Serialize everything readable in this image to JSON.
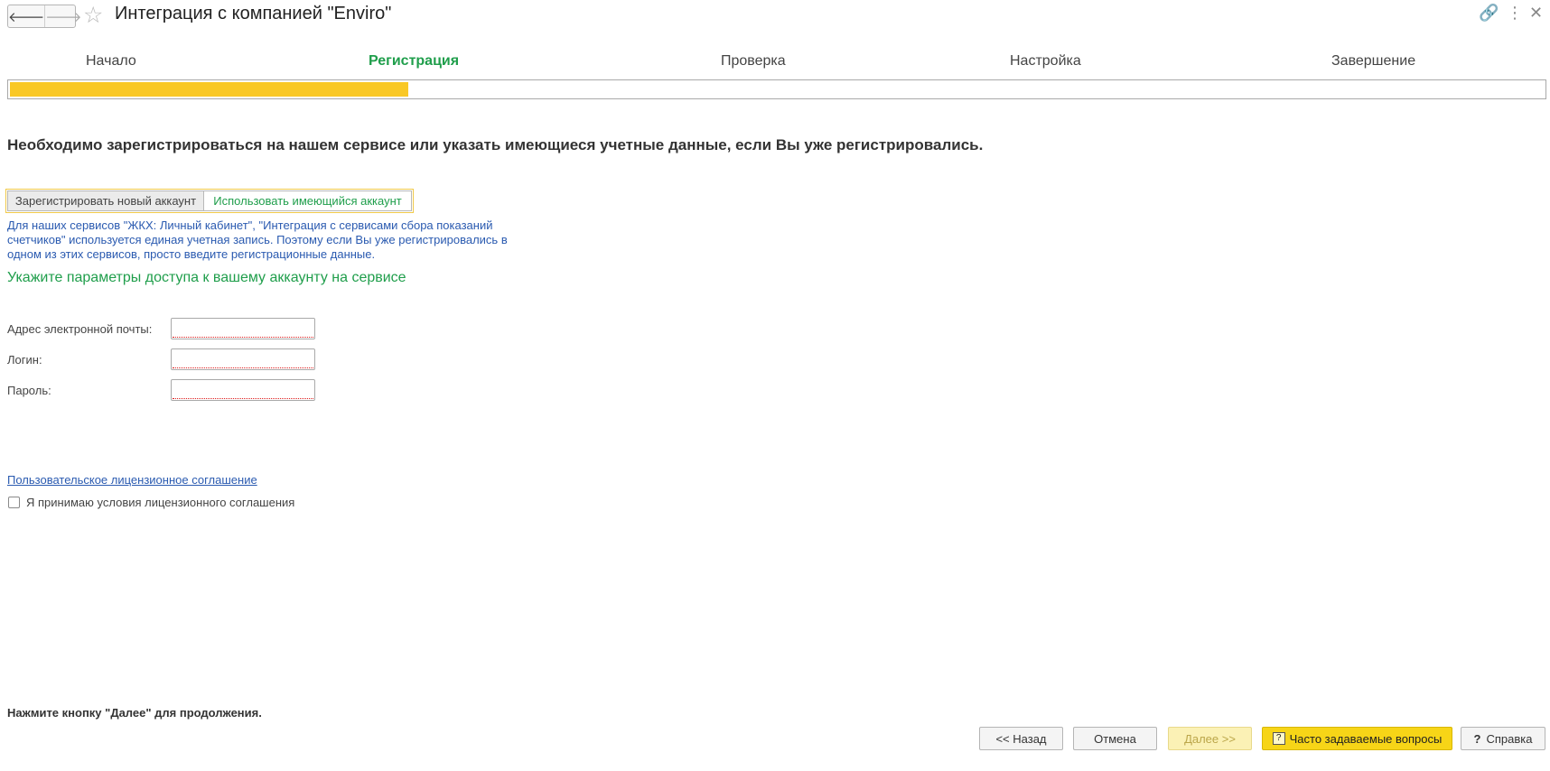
{
  "window": {
    "title": "Интеграция с компанией \"Enviro\"",
    "back_icon": "🡐",
    "forward_icon": "🡒",
    "star_icon": "☆",
    "link_icon": "🔗",
    "menu_icon": "⋮",
    "close_icon": "✕"
  },
  "steps": {
    "items": [
      "Начало",
      "Регистрация",
      "Проверка",
      "Настройка",
      "Завершение"
    ],
    "active_index": 1,
    "progress_fraction": 0.26,
    "active_color": "#1f9e4b",
    "progress_color": "#f9c825"
  },
  "main": {
    "heading": "Необходимо зарегистрироваться на нашем сервисе или указать имеющиеся учетные данные, если Вы уже регистрировались.",
    "toggle": {
      "register_label": "Зарегистрировать новый аккаунт",
      "existing_label": "Использовать имеющийся аккаунт",
      "selected": "existing"
    },
    "info_text": "Для наших сервисов \"ЖКХ: Личный кабинет\", \"Интеграция с сервисами сбора показаний счетчиков\" используется единая учетная запись. Поэтому если Вы уже регистрировались в одном из этих сервисов, просто введите регистрационные данные.",
    "subheading": "Укажите параметры доступа к вашему аккаунту на сервисе",
    "fields": {
      "email_label": "Адрес электронной почты:",
      "email_value": "",
      "login_label": "Логин:",
      "login_value": "",
      "password_label": "Пароль:",
      "password_value": ""
    },
    "license_link": "Пользовательское лицензионное соглашение",
    "accept_label": "Я принимаю условия лицензионного соглашения",
    "accept_checked": false
  },
  "footer": {
    "hint": "Нажмите кнопку \"Далее\" для продолжения.",
    "back_label": "<< Назад",
    "cancel_label": "Отмена",
    "next_label": "Далее >>",
    "faq_label": "Часто задаваемые вопросы",
    "faq_icon": "?",
    "help_label": "Справка",
    "help_icon": "?"
  }
}
